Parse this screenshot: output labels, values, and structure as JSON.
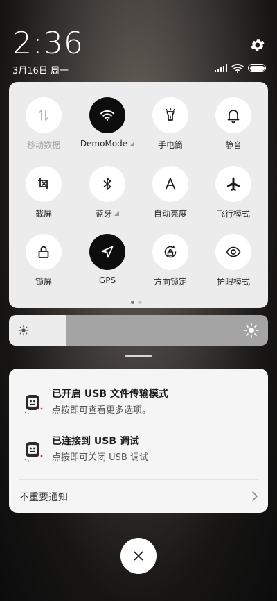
{
  "status_bar": {
    "time": "2:36",
    "date": "3月16日 周一",
    "icons": [
      "settings-icon",
      "signal-icon",
      "wifi-icon",
      "battery-icon"
    ]
  },
  "quick_settings": {
    "tiles": [
      {
        "label": "移动数据",
        "icon": "mobile-data-icon",
        "active": false,
        "disabled": true
      },
      {
        "label": "DemoMode",
        "icon": "wifi-icon",
        "active": true,
        "has_dropdown": true
      },
      {
        "label": "手电筒",
        "icon": "flashlight-icon",
        "active": false
      },
      {
        "label": "静音",
        "icon": "bell-icon",
        "active": false
      },
      {
        "label": "截屏",
        "icon": "screenshot-icon",
        "active": false
      },
      {
        "label": "蓝牙",
        "icon": "bluetooth-icon",
        "active": false,
        "has_dropdown": true
      },
      {
        "label": "自动亮度",
        "icon": "auto-brightness-icon",
        "active": false
      },
      {
        "label": "飞行模式",
        "icon": "airplane-icon",
        "active": false
      },
      {
        "label": "锁屏",
        "icon": "lock-icon",
        "active": false
      },
      {
        "label": "GPS",
        "icon": "location-icon",
        "active": true
      },
      {
        "label": "方向锁定",
        "icon": "rotation-lock-icon",
        "active": false
      },
      {
        "label": "护眼模式",
        "icon": "eye-icon",
        "active": false
      }
    ],
    "page_indicator": {
      "pages": 2,
      "current": 1
    }
  },
  "brightness": {
    "level": 0.22
  },
  "notifications": [
    {
      "title": "已开启 USB 文件传输模式",
      "subtitle": "点按即可查看更多选项。",
      "icon": "android-debug-icon"
    },
    {
      "title": "已连接到 USB 调试",
      "subtitle": "点按即可关闭 USB 调试",
      "icon": "android-debug-icon"
    }
  ],
  "less_important": "不重要通知",
  "colors": {
    "active_tile": "#0d0d0d",
    "panel": "#ececec",
    "card": "#f5f5f5"
  }
}
